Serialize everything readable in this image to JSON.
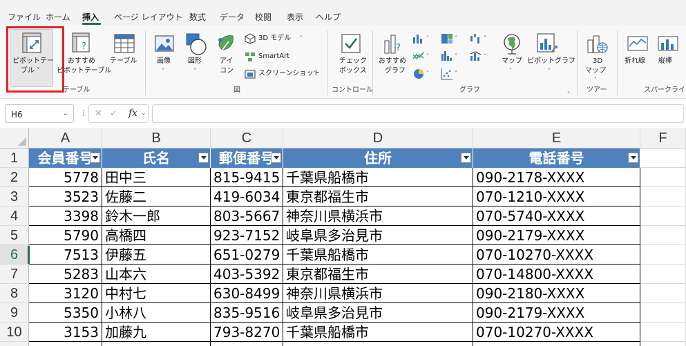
{
  "menu": {
    "tabs": [
      "ファイル",
      "ホーム",
      "挿入",
      "ページ レイアウト",
      "数式",
      "データ",
      "校閲",
      "表示",
      "ヘルプ"
    ],
    "active_tab": "挿入"
  },
  "ribbon": {
    "pivot_table": {
      "line1": "ピボットテー",
      "line2": "ブル ˅"
    },
    "recommended_pivot": {
      "line1": "おすすめ",
      "line2": "ピボットテーブル"
    },
    "table": {
      "label": "テーブル"
    },
    "group_table": "テーブル",
    "picture": {
      "label": "画像",
      "chevron": "˅"
    },
    "shapes": {
      "label": "図形",
      "chevron": "˅"
    },
    "icons": {
      "line1": "アイ",
      "line2": "コン"
    },
    "model3d": "3D モデル",
    "smartart": "SmartArt",
    "screenshot": "スクリーンショット",
    "group_illustrations": "図",
    "checkbox": {
      "line1": "チェック",
      "line2": "ボックス"
    },
    "group_controls": "コントロール",
    "recommended_charts": {
      "line1": "おすすめ",
      "line2": "グラフ"
    },
    "group_charts": "グラフ",
    "maps": {
      "label": "マップ",
      "chevron": "˅"
    },
    "pivot_chart": {
      "label": "ピボットグラフ",
      "chevron": "˅"
    },
    "map3d": {
      "line1": "3D",
      "line2": "マップ",
      "chevron": "˅"
    },
    "group_tours": "ツアー",
    "sparkline_line": "折れ線",
    "sparkline_column": "縦棒",
    "group_sparklines": "スパークライン",
    "colors": {
      "highlight": "#e8202a",
      "accent_green": "#1e7145",
      "header_blue": "#4f81bd"
    }
  },
  "formula_bar": {
    "name_box": "H6",
    "fx": "fx",
    "value": ""
  },
  "sheet": {
    "column_letters": [
      "A",
      "B",
      "C",
      "D",
      "E",
      "F"
    ],
    "row_numbers": [
      "1",
      "2",
      "3",
      "4",
      "5",
      "6",
      "7",
      "8",
      "9",
      "10"
    ],
    "selected_row": "6",
    "headers": [
      "会員番号",
      "氏名",
      "郵便番号",
      "住所",
      "電話番号"
    ],
    "rows": [
      [
        "5778",
        "田中三",
        "815-9415",
        "千葉県船橋市",
        "090-2178-XXXX"
      ],
      [
        "3523",
        "佐藤二",
        "419-6034",
        "東京都福生市",
        "070-1210-XXXX"
      ],
      [
        "3398",
        "鈴木一郎",
        "803-5667",
        "神奈川県横浜市",
        "070-5740-XXXX"
      ],
      [
        "5790",
        "高橋四",
        "923-7152",
        "岐阜県多治見市",
        "090-2179-XXXX"
      ],
      [
        "7513",
        "伊藤五",
        "651-0279",
        "千葉県船橋市",
        "070-10270-XXXX"
      ],
      [
        "5283",
        "山本六",
        "403-5392",
        "東京都福生市",
        "070-14800-XXXX"
      ],
      [
        "3120",
        "中村七",
        "630-8499",
        "神奈川県横浜市",
        "090-2180-XXXX"
      ],
      [
        "5350",
        "小林八",
        "835-9516",
        "岐阜県多治見市",
        "090-2179-XXXX"
      ],
      [
        "3153",
        "加藤九",
        "793-8270",
        "千葉県船橋市",
        "070-10270-XXXX"
      ]
    ]
  }
}
